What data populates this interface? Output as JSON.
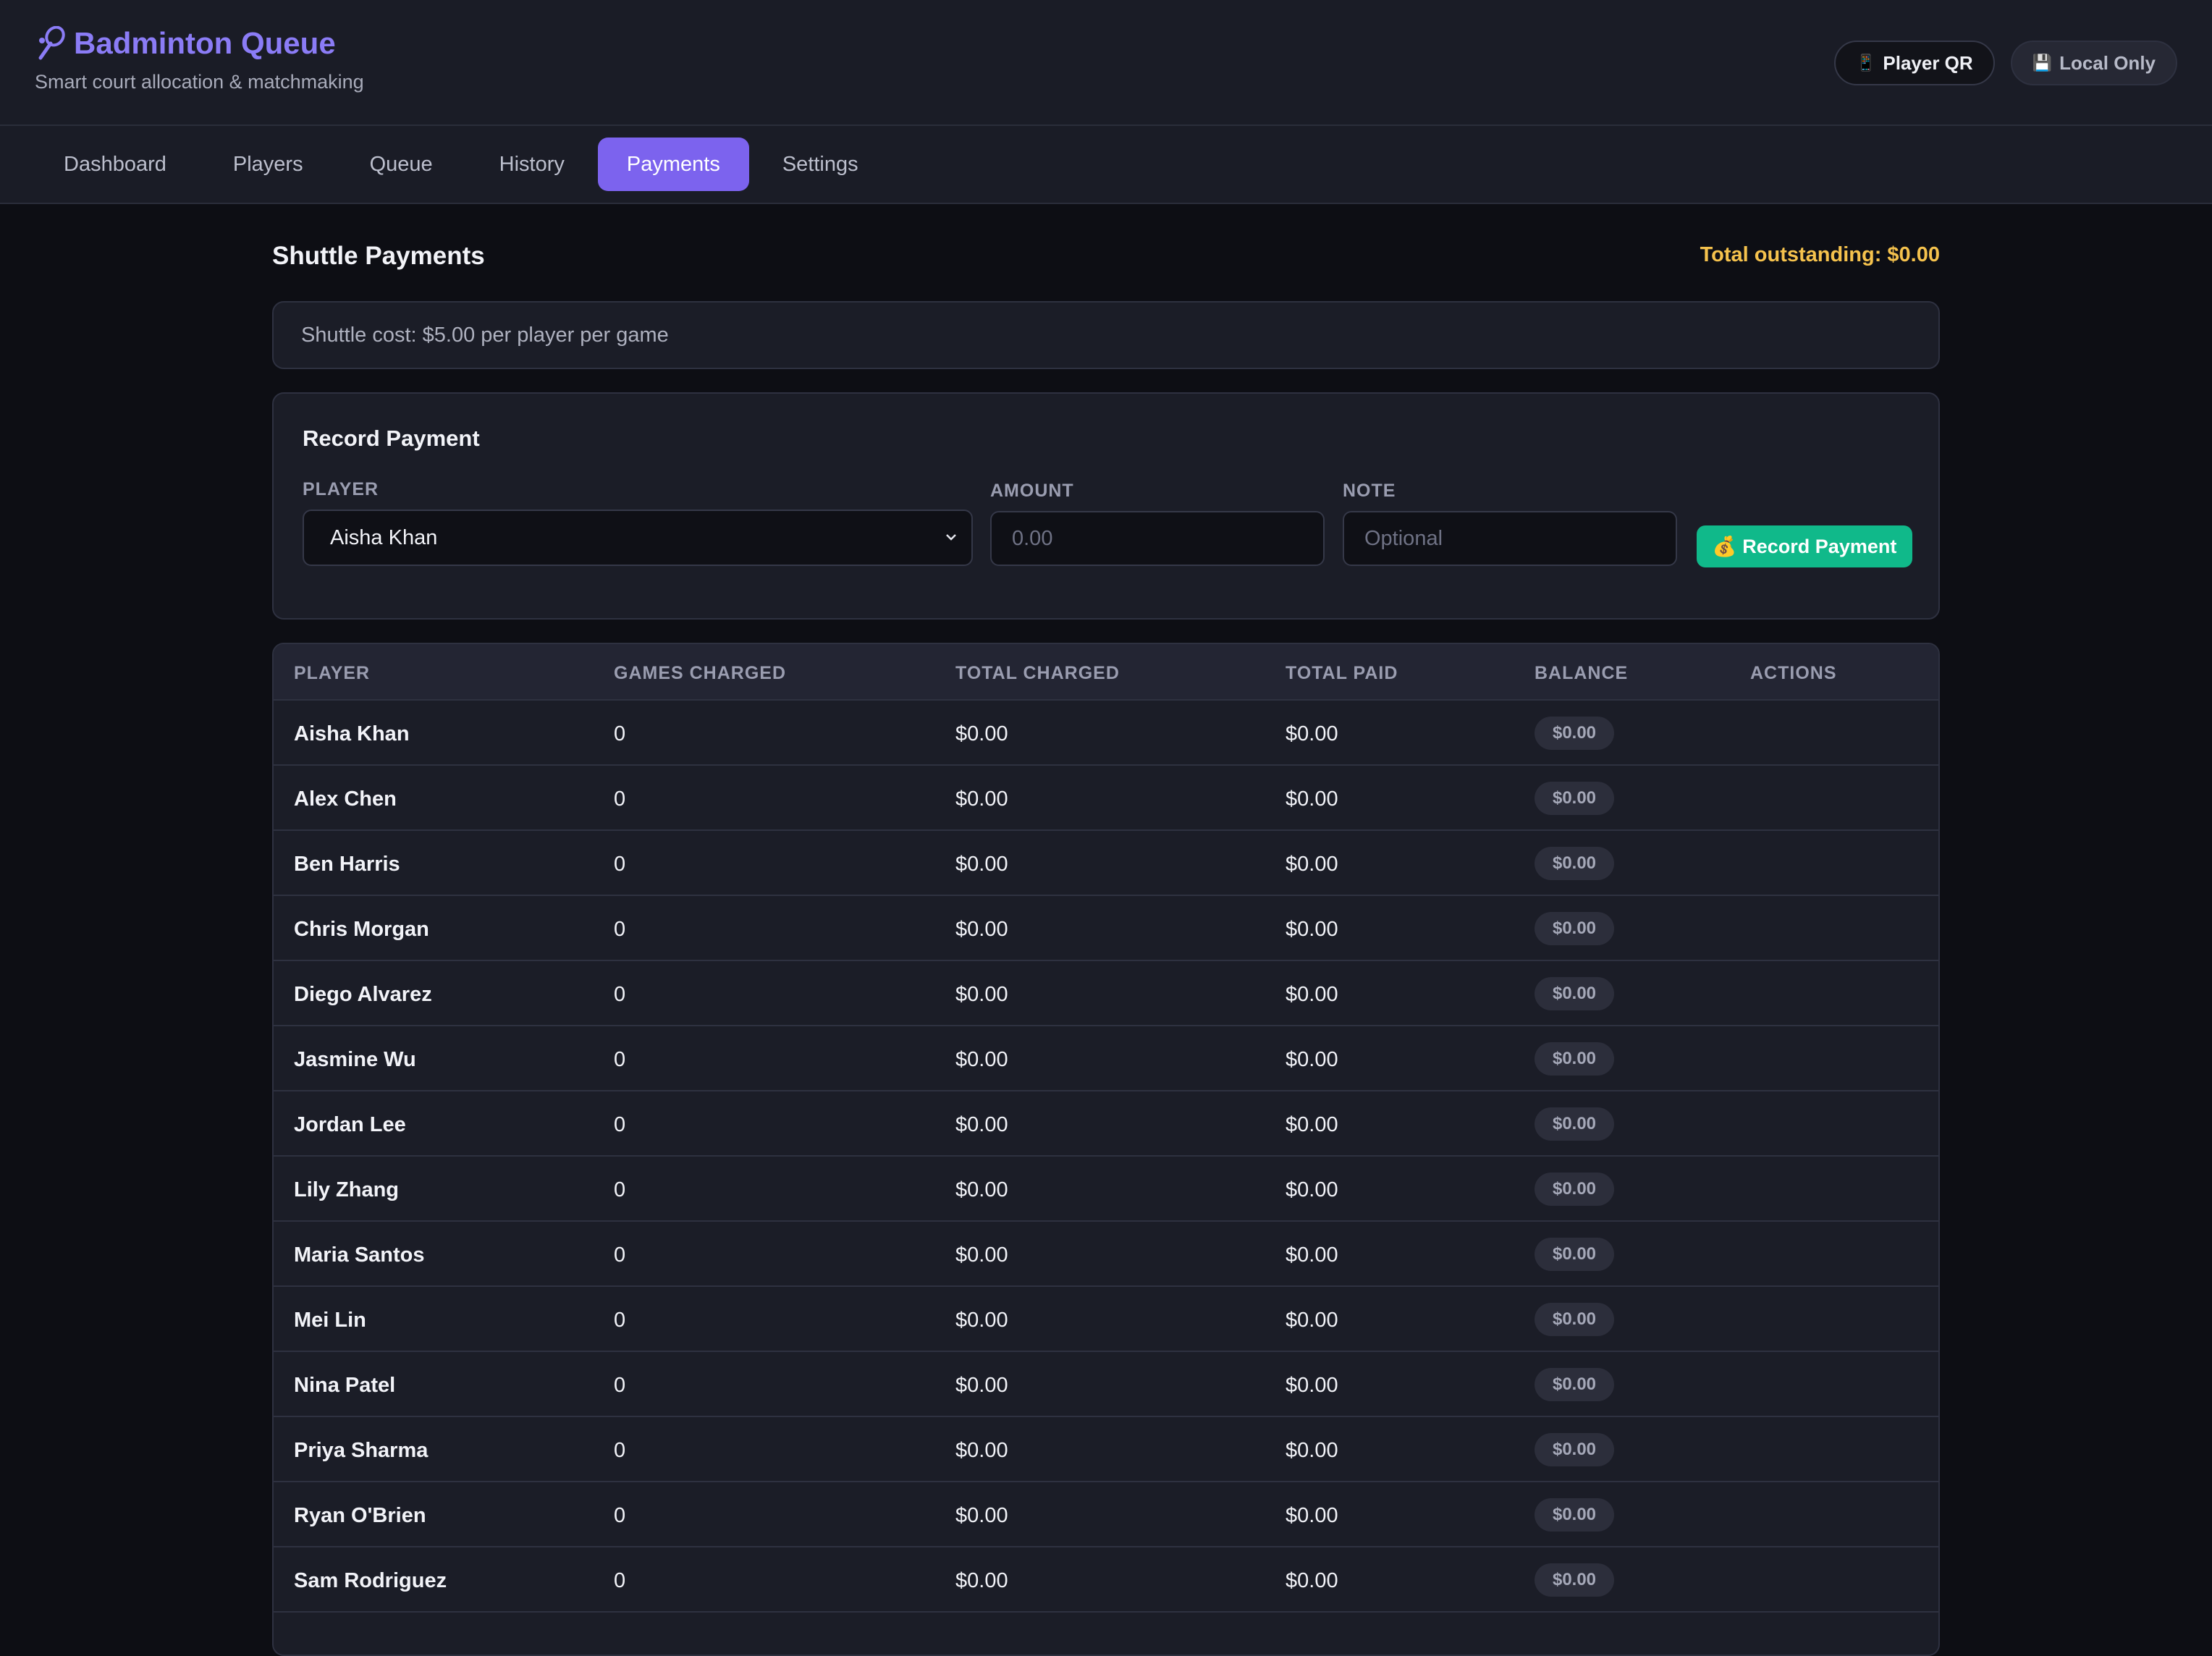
{
  "header": {
    "title": "Badminton Queue",
    "subtitle": "Smart court allocation & matchmaking",
    "logo_icon": "badminton-racket-icon",
    "actions": [
      {
        "label": "Player QR",
        "icon": "phone-icon"
      },
      {
        "label": "Local Only",
        "icon": "floppy-disk-icon"
      }
    ]
  },
  "nav": {
    "tabs": [
      "Dashboard",
      "Players",
      "Queue",
      "History",
      "Payments",
      "Settings"
    ],
    "active": "Payments"
  },
  "page": {
    "title": "Shuttle Payments",
    "outstanding": "Total outstanding: $0.00",
    "shuttle_cost": "Shuttle cost: $5.00 per player per game"
  },
  "record_payment": {
    "title": "Record Payment",
    "player_label": "PLAYER",
    "player_value": "Aisha Khan",
    "amount_label": "AMOUNT",
    "amount_placeholder": "0.00",
    "note_label": "NOTE",
    "note_placeholder": "Optional",
    "button_label": "Record Payment",
    "button_icon": "money-bag-icon"
  },
  "table": {
    "headers": [
      "PLAYER",
      "GAMES CHARGED",
      "TOTAL CHARGED",
      "TOTAL PAID",
      "BALANCE",
      "ACTIONS"
    ],
    "rows": [
      {
        "name": "Aisha Khan",
        "games": "0",
        "charged": "$0.00",
        "paid": "$0.00",
        "balance": "$0.00"
      },
      {
        "name": "Alex Chen",
        "games": "0",
        "charged": "$0.00",
        "paid": "$0.00",
        "balance": "$0.00"
      },
      {
        "name": "Ben Harris",
        "games": "0",
        "charged": "$0.00",
        "paid": "$0.00",
        "balance": "$0.00"
      },
      {
        "name": "Chris Morgan",
        "games": "0",
        "charged": "$0.00",
        "paid": "$0.00",
        "balance": "$0.00"
      },
      {
        "name": "Diego Alvarez",
        "games": "0",
        "charged": "$0.00",
        "paid": "$0.00",
        "balance": "$0.00"
      },
      {
        "name": "Jasmine Wu",
        "games": "0",
        "charged": "$0.00",
        "paid": "$0.00",
        "balance": "$0.00"
      },
      {
        "name": "Jordan Lee",
        "games": "0",
        "charged": "$0.00",
        "paid": "$0.00",
        "balance": "$0.00"
      },
      {
        "name": "Lily Zhang",
        "games": "0",
        "charged": "$0.00",
        "paid": "$0.00",
        "balance": "$0.00"
      },
      {
        "name": "Maria Santos",
        "games": "0",
        "charged": "$0.00",
        "paid": "$0.00",
        "balance": "$0.00"
      },
      {
        "name": "Mei Lin",
        "games": "0",
        "charged": "$0.00",
        "paid": "$0.00",
        "balance": "$0.00"
      },
      {
        "name": "Nina Patel",
        "games": "0",
        "charged": "$0.00",
        "paid": "$0.00",
        "balance": "$0.00"
      },
      {
        "name": "Priya Sharma",
        "games": "0",
        "charged": "$0.00",
        "paid": "$0.00",
        "balance": "$0.00"
      },
      {
        "name": "Ryan O'Brien",
        "games": "0",
        "charged": "$0.00",
        "paid": "$0.00",
        "balance": "$0.00"
      },
      {
        "name": "Sam Rodriguez",
        "games": "0",
        "charged": "$0.00",
        "paid": "$0.00",
        "balance": "$0.00"
      }
    ]
  },
  "colors": {
    "accent": "#7c63ee",
    "brand": "#8b7cf6",
    "success": "#10b98a",
    "warning": "#f5c24d"
  }
}
